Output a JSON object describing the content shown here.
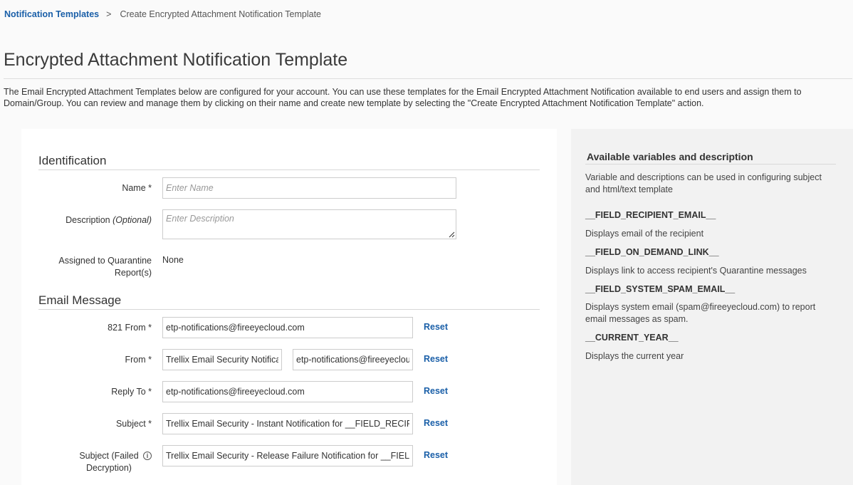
{
  "breadcrumb": {
    "parent": "Notification Templates",
    "separator": ">",
    "current": "Create Encrypted Attachment Notification Template"
  },
  "page": {
    "title": "Encrypted Attachment Notification Template",
    "intro": "The Email Encrypted Attachment Templates below are configured for your account. You can use these templates for the Email Encrypted Attachment Notification available to end users and assign them to Domain/Group. You can review and manage them by clicking on their name and create new template by selecting the \"Create Encrypted Attachment Notification Template\" action."
  },
  "identification": {
    "title": "Identification",
    "name_label": "Name *",
    "name_placeholder": "Enter Name",
    "description_label": "Description",
    "description_optional": "(Optional)",
    "description_placeholder": "Enter Description",
    "assigned_label": "Assigned to Quarantine Report(s)",
    "assigned_value": "None"
  },
  "email_message": {
    "title": "Email Message",
    "from821_label": "821 From *",
    "from821_value": "etp-notifications@fireeyecloud.com",
    "from_label": "From *",
    "from_name_value": "Trellix Email Security Notifications",
    "from_email_value": "etp-notifications@fireeyecloud.com",
    "reply_to_label": "Reply To *",
    "reply_to_value": "etp-notifications@fireeyecloud.com",
    "subject_label": "Subject *",
    "subject_value": "Trellix Email Security - Instant Notification for __FIELD_RECIPIENT_EMAIL__",
    "subject_failed_label": "Subject (Failed Decryption)",
    "subject_failed_value": "Trellix Email Security - Release Failure Notification for __FIELD_RECIPIENT_EMAIL__",
    "reset_label": "Reset",
    "info_icon_glyph": "i"
  },
  "variables": {
    "title": "Available variables and description",
    "intro": "Variable and descriptions can be used in configuring subject and html/text template",
    "items": [
      {
        "name": "__FIELD_RECIPIENT_EMAIL__",
        "desc": "Displays email of the recipient"
      },
      {
        "name": "__FIELD_ON_DEMAND_LINK__",
        "desc": "Displays link to access recipient's Quarantine messages"
      },
      {
        "name": "__FIELD_SYSTEM_SPAM_EMAIL__",
        "desc": "Displays system email (spam@fireeyecloud.com) to report email messages as spam."
      },
      {
        "name": "__CURRENT_YEAR__",
        "desc": "Displays the current year"
      }
    ]
  },
  "colors": {
    "link": "#1a5fa8",
    "background": "#fafafa",
    "panel": "#ffffff",
    "side_panel": "#f2f2f2"
  }
}
